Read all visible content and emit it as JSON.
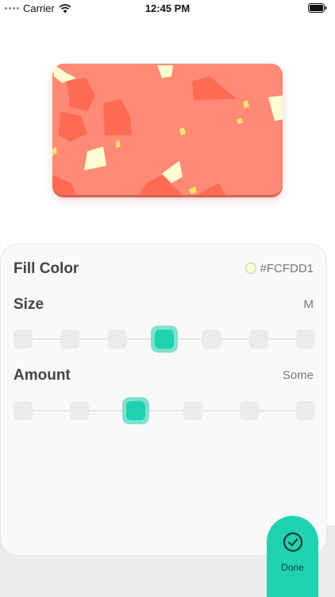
{
  "status_bar": {
    "carrier": "Carrier",
    "time": "12:45 PM"
  },
  "card_preview": {
    "base_color": "#FF8A75",
    "shard_colors": [
      "#FF6A55",
      "#FCFDD1",
      "#F5E36A"
    ]
  },
  "panel": {
    "fill_color": {
      "label": "Fill Color",
      "value": "#FCFDD1",
      "swatch": "#FCFDD1"
    },
    "size": {
      "label": "Size",
      "value": "M",
      "steps": 7,
      "selected_index": 3
    },
    "amount": {
      "label": "Amount",
      "value": "Some",
      "steps": 6,
      "selected_index": 2
    }
  },
  "done_button": {
    "label": "Done",
    "icon": "check-circle-icon"
  },
  "accent_color": "#1FD1AE"
}
